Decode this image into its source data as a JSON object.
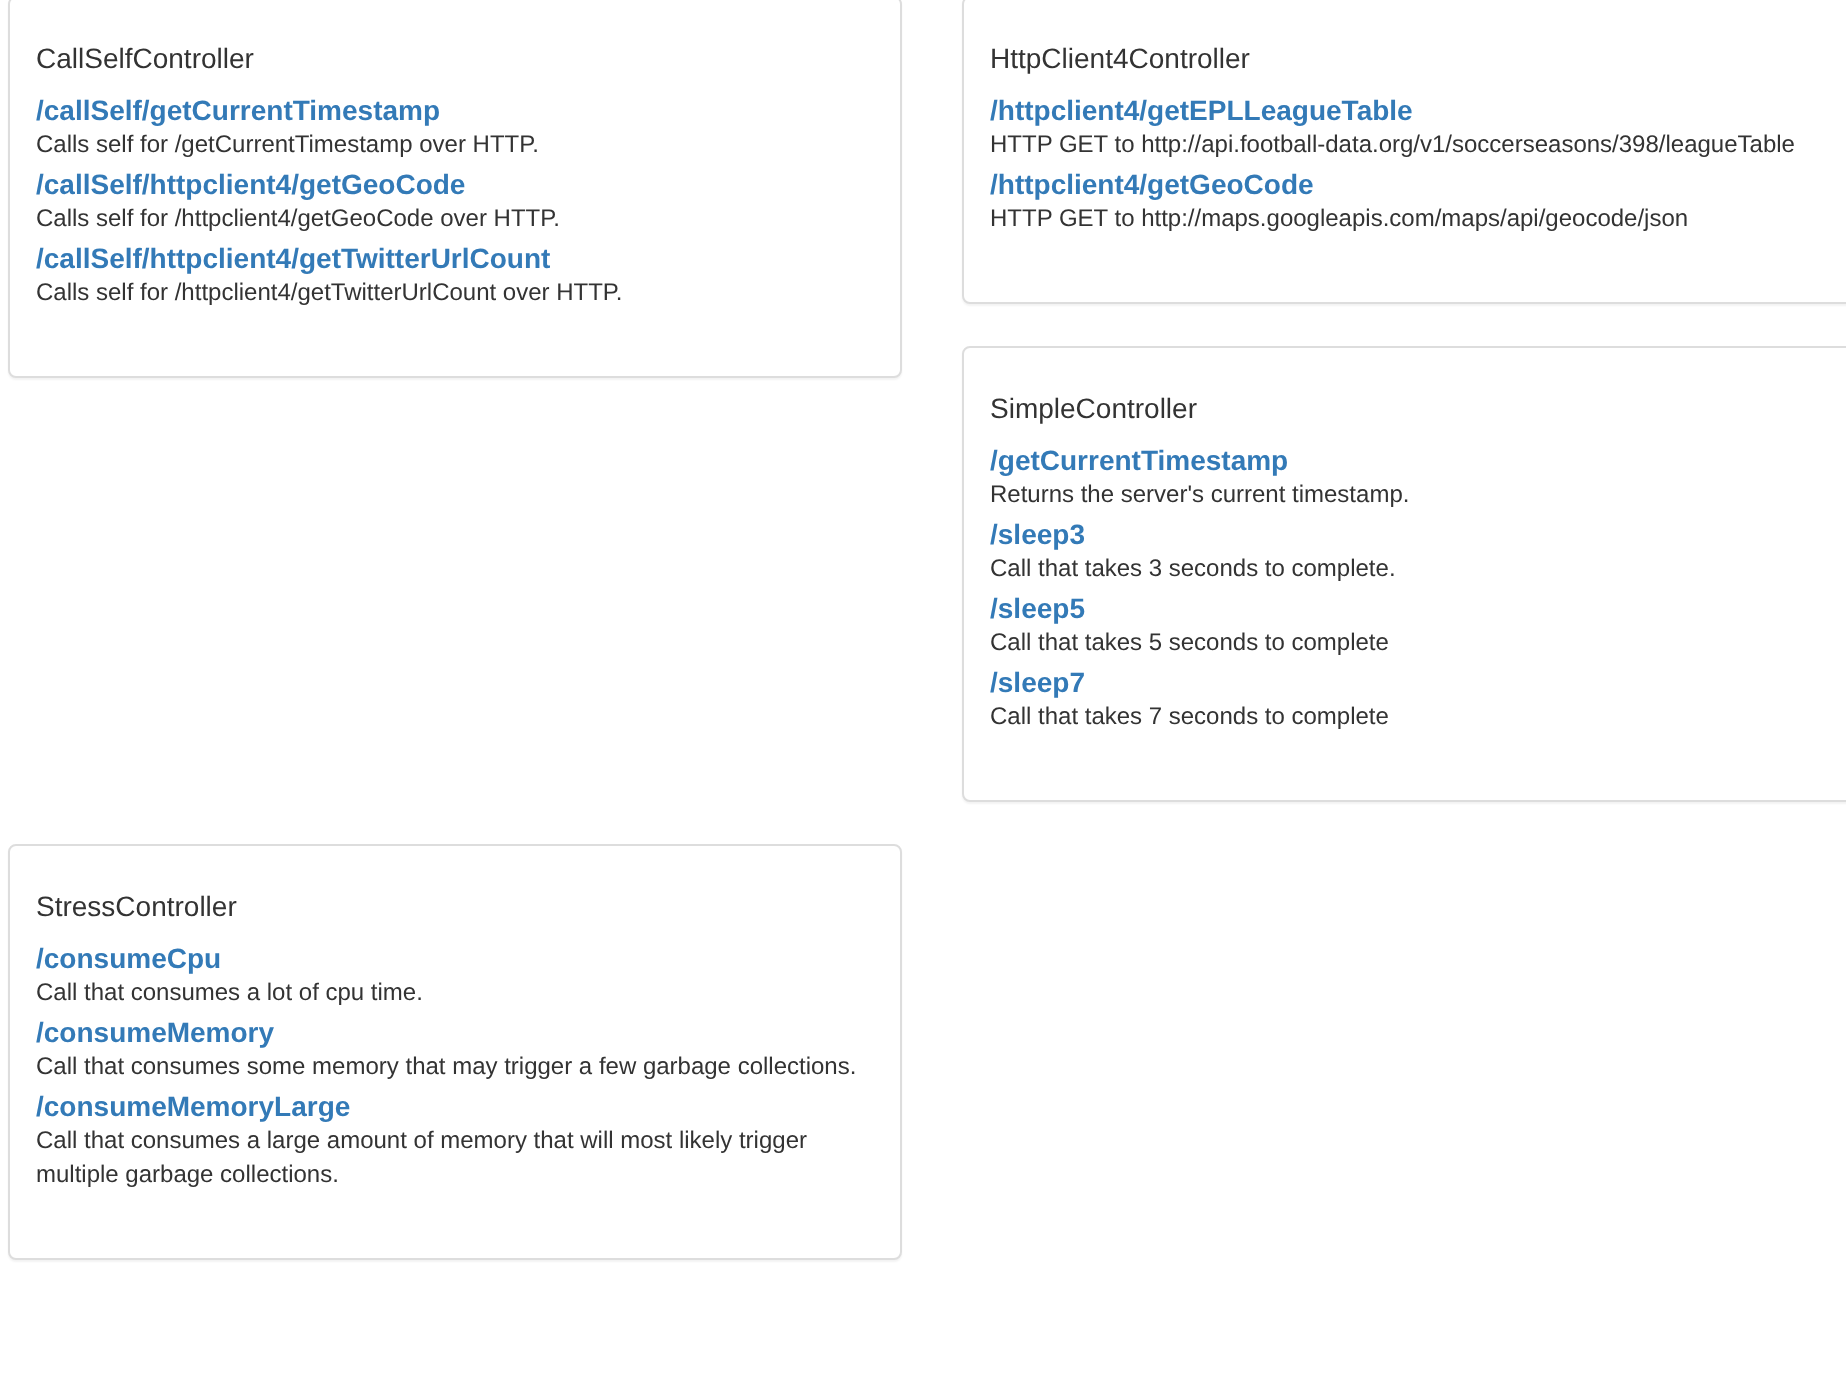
{
  "rows": [
    {
      "columns": [
        {
          "panels": [
            {
              "title": "CallSelfController",
              "endpoints": [
                {
                  "path": "/callSelf/getCurrentTimestamp",
                  "description": "Calls self for /getCurrentTimestamp over HTTP."
                },
                {
                  "path": "/callSelf/httpclient4/getGeoCode",
                  "description": "Calls self for /httpclient4/getGeoCode over HTTP."
                },
                {
                  "path": "/callSelf/httpclient4/getTwitterUrlCount",
                  "description": "Calls self for /httpclient4/getTwitterUrlCount over HTTP."
                }
              ]
            }
          ]
        },
        {
          "panels": [
            {
              "title": "HttpClient4Controller",
              "endpoints": [
                {
                  "path": "/httpclient4/getEPLLeagueTable",
                  "description": "HTTP GET to http://api.football-data.org/v1/soccerseasons/398/leagueTable"
                },
                {
                  "path": "/httpclient4/getGeoCode",
                  "description": "HTTP GET to http://maps.googleapis.com/maps/api/geocode/json"
                }
              ]
            },
            {
              "title": "SimpleController",
              "endpoints": [
                {
                  "path": "/getCurrentTimestamp",
                  "description": "Returns the server's current timestamp."
                },
                {
                  "path": "/sleep3",
                  "description": "Call that takes 3 seconds to complete."
                },
                {
                  "path": "/sleep5",
                  "description": "Call that takes 5 seconds to complete"
                },
                {
                  "path": "/sleep7",
                  "description": "Call that takes 7 seconds to complete"
                }
              ]
            }
          ]
        }
      ]
    },
    {
      "columns": [
        {
          "panels": [
            {
              "title": "StressController",
              "endpoints": [
                {
                  "path": "/consumeCpu",
                  "description": "Call that consumes a lot of cpu time."
                },
                {
                  "path": "/consumeMemory",
                  "description": "Call that consumes some memory that may trigger a few garbage collections."
                },
                {
                  "path": "/consumeMemoryLarge",
                  "description": "Call that consumes a large amount of memory that will most likely trigger multiple garbage collections."
                }
              ]
            }
          ]
        }
      ]
    }
  ]
}
